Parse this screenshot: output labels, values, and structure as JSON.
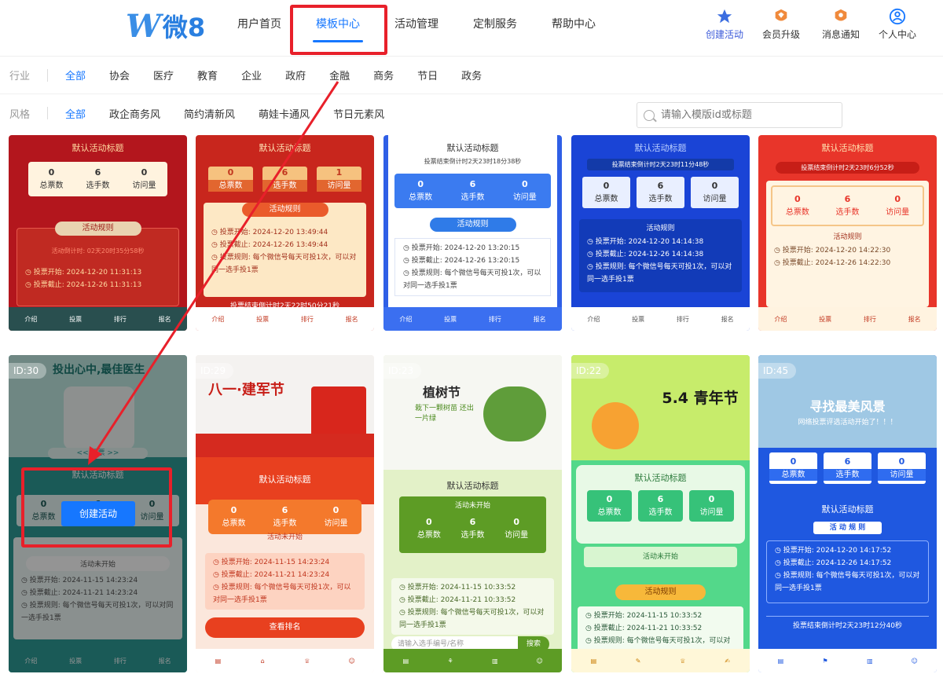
{
  "header": {
    "logo": {
      "mark": "W",
      "text": "微8"
    },
    "nav": [
      "用户首页",
      "模板中心",
      "活动管理",
      "定制服务",
      "帮助中心"
    ],
    "active_nav": 1,
    "actions": [
      {
        "label": "创建活动",
        "icon": "star-icon",
        "color": "#3b5ad9"
      },
      {
        "label": "会员升级",
        "icon": "crown-icon",
        "color": "#f08a3c"
      },
      {
        "label": "消息通知",
        "icon": "bell-icon",
        "color": "#f08a3c"
      },
      {
        "label": "个人中心",
        "icon": "user-icon",
        "color": "#1677ff"
      }
    ]
  },
  "filters": {
    "industry": {
      "label": "行业",
      "options": [
        "全部",
        "协会",
        "医疗",
        "教育",
        "企业",
        "政府",
        "金融",
        "商务",
        "节日",
        "政务"
      ],
      "selected": 0
    },
    "style": {
      "label": "风格",
      "options": [
        "全部",
        "政企商务风",
        "简约清新风",
        "萌娃卡通风",
        "节日元素风"
      ],
      "selected": 0
    },
    "search_placeholder": "请输入模版id或标题"
  },
  "common": {
    "default_title": "默认活动标题",
    "stat_labels": [
      "总票数",
      "选手数",
      "访问量"
    ],
    "stat_values": [
      "0",
      "6",
      "0"
    ],
    "rule_label": "活动规则",
    "not_started": "活动未开始",
    "start_prefix": "投票开始:",
    "end_prefix": "投票截止:",
    "rule_prefix": "投票规则:",
    "rule_text": "每个微信号每天可投1次，可以对同一选手投1票"
  },
  "row1": [
    {
      "title": "默认活动标题",
      "countdown": "活动倒计时: 02天20时35分58秒",
      "start": "2024-12-20 11:31:13",
      "end": "2024-12-26 11:31:13",
      "nav": [
        "介绍",
        "投票",
        "排行",
        "报名"
      ]
    },
    {
      "title": "默认活动标题",
      "rule": "活动规则",
      "start": "2024-12-20 13:49:44",
      "end": "2024-12-26 13:49:44",
      "countdown": "投票结束倒计时2天22时50分21秒",
      "nav": [
        "介绍",
        "投票",
        "排行",
        "报名"
      ]
    },
    {
      "title": "默认活动标题",
      "countdown": "投票结束倒计时2天23时18分38秒",
      "rule": "活动规则",
      "start": "2024-12-20 13:20:15",
      "end": "2024-12-26 13:20:15",
      "nav": [
        "介绍",
        "投票",
        "排行",
        "报名"
      ]
    },
    {
      "title": "默认活动标题",
      "countdown": "投票结束倒计时2天23时11分48秒",
      "rule": "活动规则",
      "start": "2024-12-20 14:14:38",
      "end": "2024-12-26 14:14:38",
      "nav": [
        "介绍",
        "投票",
        "排行",
        "报名"
      ]
    },
    {
      "title": "默认活动标题",
      "countdown": "投票结束倒计时2天23时6分52秒",
      "rule": "活动规则",
      "start": "2024-12-20 14:22:30",
      "end": "2024-12-26 14:22:30",
      "nav": [
        "介绍",
        "投票",
        "排行",
        "报名"
      ]
    }
  ],
  "row2": [
    {
      "id": "ID:30",
      "banner": "投出心中,最佳医生",
      "pill": "<< 投票 >>",
      "title": "默认活动标题",
      "status": "活动未开始",
      "start": "2024-11-15 14:23:24",
      "end": "2024-11-21 14:23:24",
      "button": "创建活动",
      "nav": [
        "介绍",
        "投票",
        "排行",
        "报名"
      ]
    },
    {
      "id": "ID:29",
      "banner": "八一·建军节",
      "title": "默认活动标题",
      "status": "活动未开始",
      "start": "2024-11-15 14:23:24",
      "end": "2024-11-21 14:23:24",
      "button": "查看排名"
    },
    {
      "id": "ID:23",
      "banner": "植树节",
      "sub": "栽下一颗树苗 还出一片绿",
      "title": "默认活动标题",
      "status": "活动未开始",
      "start": "2024-11-15 10:33:52",
      "end": "2024-11-21 10:33:52",
      "search": "请输入选手编号/名称",
      "search_btn": "搜索"
    },
    {
      "id": "ID:22",
      "banner": "5.4 青年节",
      "title": "默认活动标题",
      "status": "活动未开始",
      "rule": "活动规则",
      "start": "2024-11-15 10:33:52",
      "end": "2024-11-21 10:33:52"
    },
    {
      "id": "ID:45",
      "banner": "寻找最美风景",
      "sub": "网络投票评选活动开始了！！！",
      "title": "默认活动标题",
      "rule": "活 动 规 则",
      "start": "2024-12-20 14:17:52",
      "end": "2024-12-26 14:17:52",
      "countdown": "投票结束倒计时2天23时12分40秒"
    }
  ]
}
